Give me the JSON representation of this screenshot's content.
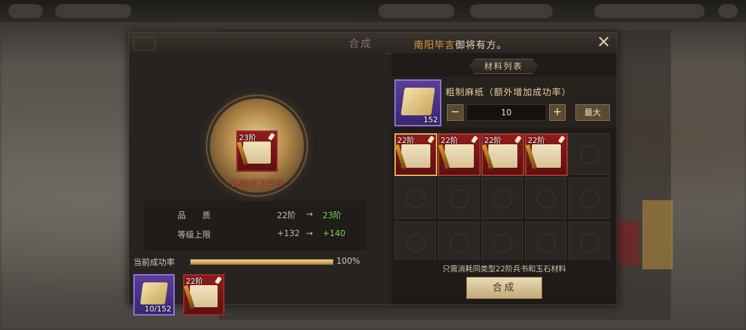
{
  "dialog": {
    "title": "合成",
    "subtitle_name": "南阳毕言",
    "subtitle_rest": "御将有方。",
    "close_icon": "close-x-icon"
  },
  "target_item": {
    "tier": "23阶",
    "name": "23阶近卫兵书"
  },
  "stats": [
    {
      "label": "品　　质",
      "from": "22阶",
      "to": "23阶"
    },
    {
      "label": "等级上限",
      "from": "+132",
      "to": "+140"
    }
  ],
  "success": {
    "label": "当前成功率",
    "value": 100,
    "value_text": "100%"
  },
  "bottom_slots": {
    "paper_count": "10/152",
    "book_tier": "22阶"
  },
  "materials": {
    "tab_label": "材料列表",
    "item_title": "粗制麻纸（额外增加成功率）",
    "item_count": "152",
    "quantity": "10",
    "minus_label": "−",
    "plus_label": "+",
    "max_label": "最大"
  },
  "grid": {
    "filled_tiers": [
      "22阶",
      "22阶",
      "22阶",
      "22阶"
    ],
    "selected_index": 0
  },
  "footer": {
    "note": "只需消耗同类型22阶兵书和玉石材料",
    "compose_label": "合成"
  },
  "colors": {
    "accent_gold": "#c4ab78",
    "success_green": "#7fcf58",
    "item_red": "#e2553a",
    "name_orange": "#e59a3a"
  }
}
